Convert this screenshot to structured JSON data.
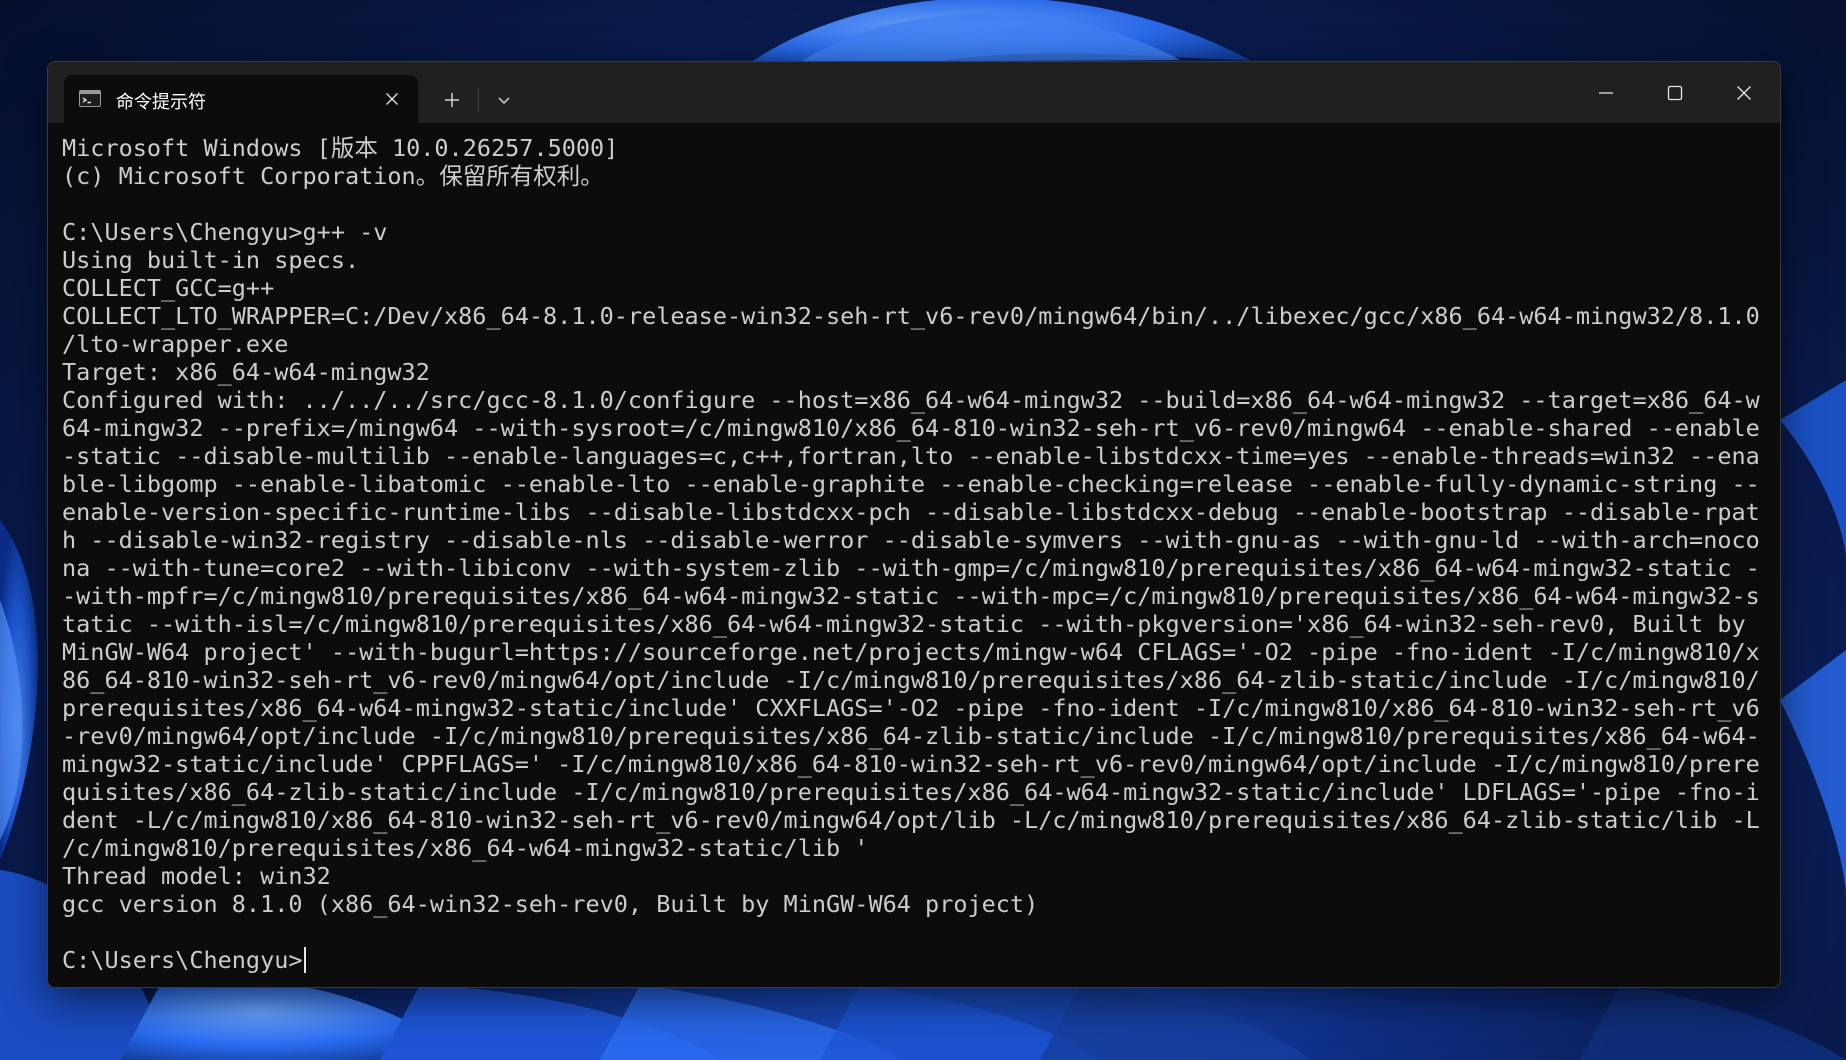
{
  "window": {
    "tab_title": "命令提示符",
    "tab_icon": "command-prompt-icon",
    "new_tab_icon": "plus-icon",
    "dropdown_icon": "chevron-down-icon",
    "minimize_icon": "minimize-icon",
    "maximize_icon": "maximize-icon",
    "close_icon": "close-icon"
  },
  "console": {
    "lines": [
      "Microsoft Windows [版本 10.0.26257.5000]",
      "(c) Microsoft Corporation。保留所有权利。",
      "",
      "C:\\Users\\Chengyu>g++ -v",
      "Using built-in specs.",
      "COLLECT_GCC=g++",
      "COLLECT_LTO_WRAPPER=C:/Dev/x86_64-8.1.0-release-win32-seh-rt_v6-rev0/mingw64/bin/../libexec/gcc/x86_64-w64-mingw32/8.1.0",
      "/lto-wrapper.exe",
      "Target: x86_64-w64-mingw32",
      "Configured with: ../../../src/gcc-8.1.0/configure --host=x86_64-w64-mingw32 --build=x86_64-w64-mingw32 --target=x86_64-w",
      "64-mingw32 --prefix=/mingw64 --with-sysroot=/c/mingw810/x86_64-810-win32-seh-rt_v6-rev0/mingw64 --enable-shared --enable",
      "-static --disable-multilib --enable-languages=c,c++,fortran,lto --enable-libstdcxx-time=yes --enable-threads=win32 --ena",
      "ble-libgomp --enable-libatomic --enable-lto --enable-graphite --enable-checking=release --enable-fully-dynamic-string --",
      "enable-version-specific-runtime-libs --disable-libstdcxx-pch --disable-libstdcxx-debug --enable-bootstrap --disable-rpat",
      "h --disable-win32-registry --disable-nls --disable-werror --disable-symvers --with-gnu-as --with-gnu-ld --with-arch=noco",
      "na --with-tune=core2 --with-libiconv --with-system-zlib --with-gmp=/c/mingw810/prerequisites/x86_64-w64-mingw32-static -",
      "-with-mpfr=/c/mingw810/prerequisites/x86_64-w64-mingw32-static --with-mpc=/c/mingw810/prerequisites/x86_64-w64-mingw32-s",
      "tatic --with-isl=/c/mingw810/prerequisites/x86_64-w64-mingw32-static --with-pkgversion='x86_64-win32-seh-rev0, Built by",
      "MinGW-W64 project' --with-bugurl=https://sourceforge.net/projects/mingw-w64 CFLAGS='-O2 -pipe -fno-ident -I/c/mingw810/x",
      "86_64-810-win32-seh-rt_v6-rev0/mingw64/opt/include -I/c/mingw810/prerequisites/x86_64-zlib-static/include -I/c/mingw810/",
      "prerequisites/x86_64-w64-mingw32-static/include' CXXFLAGS='-O2 -pipe -fno-ident -I/c/mingw810/x86_64-810-win32-seh-rt_v6",
      "-rev0/mingw64/opt/include -I/c/mingw810/prerequisites/x86_64-zlib-static/include -I/c/mingw810/prerequisites/x86_64-w64-",
      "mingw32-static/include' CPPFLAGS=' -I/c/mingw810/x86_64-810-win32-seh-rt_v6-rev0/mingw64/opt/include -I/c/mingw810/prere",
      "quisites/x86_64-zlib-static/include -I/c/mingw810/prerequisites/x86_64-w64-mingw32-static/include' LDFLAGS='-pipe -fno-i",
      "dent -L/c/mingw810/x86_64-810-win32-seh-rt_v6-rev0/mingw64/opt/lib -L/c/mingw810/prerequisites/x86_64-zlib-static/lib -L",
      "/c/mingw810/prerequisites/x86_64-w64-mingw32-static/lib '",
      "Thread model: win32",
      "gcc version 8.1.0 (x86_64-win32-seh-rev0, Built by MinGW-W64 project)",
      ""
    ],
    "prompt": "C:\\Users\\Chengyu>"
  }
}
